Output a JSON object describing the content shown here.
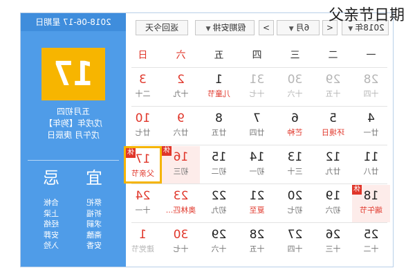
{
  "watermark": "父亲节日期",
  "info": {
    "date": "2018-06-17 星期日",
    "day": "17",
    "lunar_lines": [
      "五月初四",
      "戊戌年【狗年】",
      "戊午月 庚辰日"
    ],
    "yi_label": "宜",
    "ji_label": "忌",
    "yi_items": [
      "祭祀",
      "祈福",
      "求嗣",
      "斋醮",
      "安香"
    ],
    "ji_items": [
      "合帐",
      "上梁",
      "经络",
      "安葬",
      "入殓"
    ]
  },
  "toolbar": {
    "year": "2018年",
    "month": "6月",
    "holiday": "假期安排",
    "today": "返回今天",
    "prev_symbol": "<",
    "next_symbol": ">",
    "caret": "▼"
  },
  "weekdays": [
    "一",
    "二",
    "三",
    "四",
    "五",
    "六",
    "日"
  ],
  "weeks": [
    [
      {
        "n": "28",
        "l": "十四",
        "other": true
      },
      {
        "n": "29",
        "l": "十五",
        "other": true
      },
      {
        "n": "30",
        "l": "十六",
        "other": true
      },
      {
        "n": "31",
        "l": "十七",
        "other": true
      },
      {
        "n": "1",
        "l": "儿童节",
        "festival": true
      },
      {
        "n": "2",
        "l": "十九",
        "weekend": true
      },
      {
        "n": "3",
        "l": "二十",
        "weekend": true
      }
    ],
    [
      {
        "n": "4",
        "l": "廿一"
      },
      {
        "n": "5",
        "l": "环境日",
        "festival": true
      },
      {
        "n": "6",
        "l": "芒种",
        "festival": true
      },
      {
        "n": "7",
        "l": "廿四"
      },
      {
        "n": "8",
        "l": "廿五"
      },
      {
        "n": "9",
        "l": "廿六",
        "weekend": true
      },
      {
        "n": "10",
        "l": "廿七",
        "weekend": true
      }
    ],
    [
      {
        "n": "11",
        "l": "廿八"
      },
      {
        "n": "12",
        "l": "廿九"
      },
      {
        "n": "13",
        "l": "三十"
      },
      {
        "n": "14",
        "l": "初一"
      },
      {
        "n": "15",
        "l": "初二"
      },
      {
        "n": "16",
        "l": "初三",
        "weekend": true,
        "holiday": true,
        "badge": "休"
      },
      {
        "n": "17",
        "l": "父亲节",
        "weekend": true,
        "festival": true,
        "selected": true,
        "badge": "休"
      }
    ],
    [
      {
        "n": "18",
        "l": "端午节",
        "festival": true,
        "holiday": true,
        "badge": "休"
      },
      {
        "n": "19",
        "l": "初六"
      },
      {
        "n": "20",
        "l": "初七"
      },
      {
        "n": "21",
        "l": "夏至",
        "festival": true
      },
      {
        "n": "22",
        "l": "初九"
      },
      {
        "n": "23",
        "l": "奥林匹...",
        "weekend": true,
        "festival": true
      },
      {
        "n": "24",
        "l": "十一",
        "weekend": true
      }
    ],
    [
      {
        "n": "25",
        "l": "十二"
      },
      {
        "n": "26",
        "l": "十三"
      },
      {
        "n": "27",
        "l": "十四"
      },
      {
        "n": "28",
        "l": "十五"
      },
      {
        "n": "29",
        "l": "十六"
      },
      {
        "n": "30",
        "l": "十七",
        "weekend": true
      },
      {
        "n": "1",
        "l": "建党节",
        "other": true,
        "weekend": true
      }
    ]
  ]
}
